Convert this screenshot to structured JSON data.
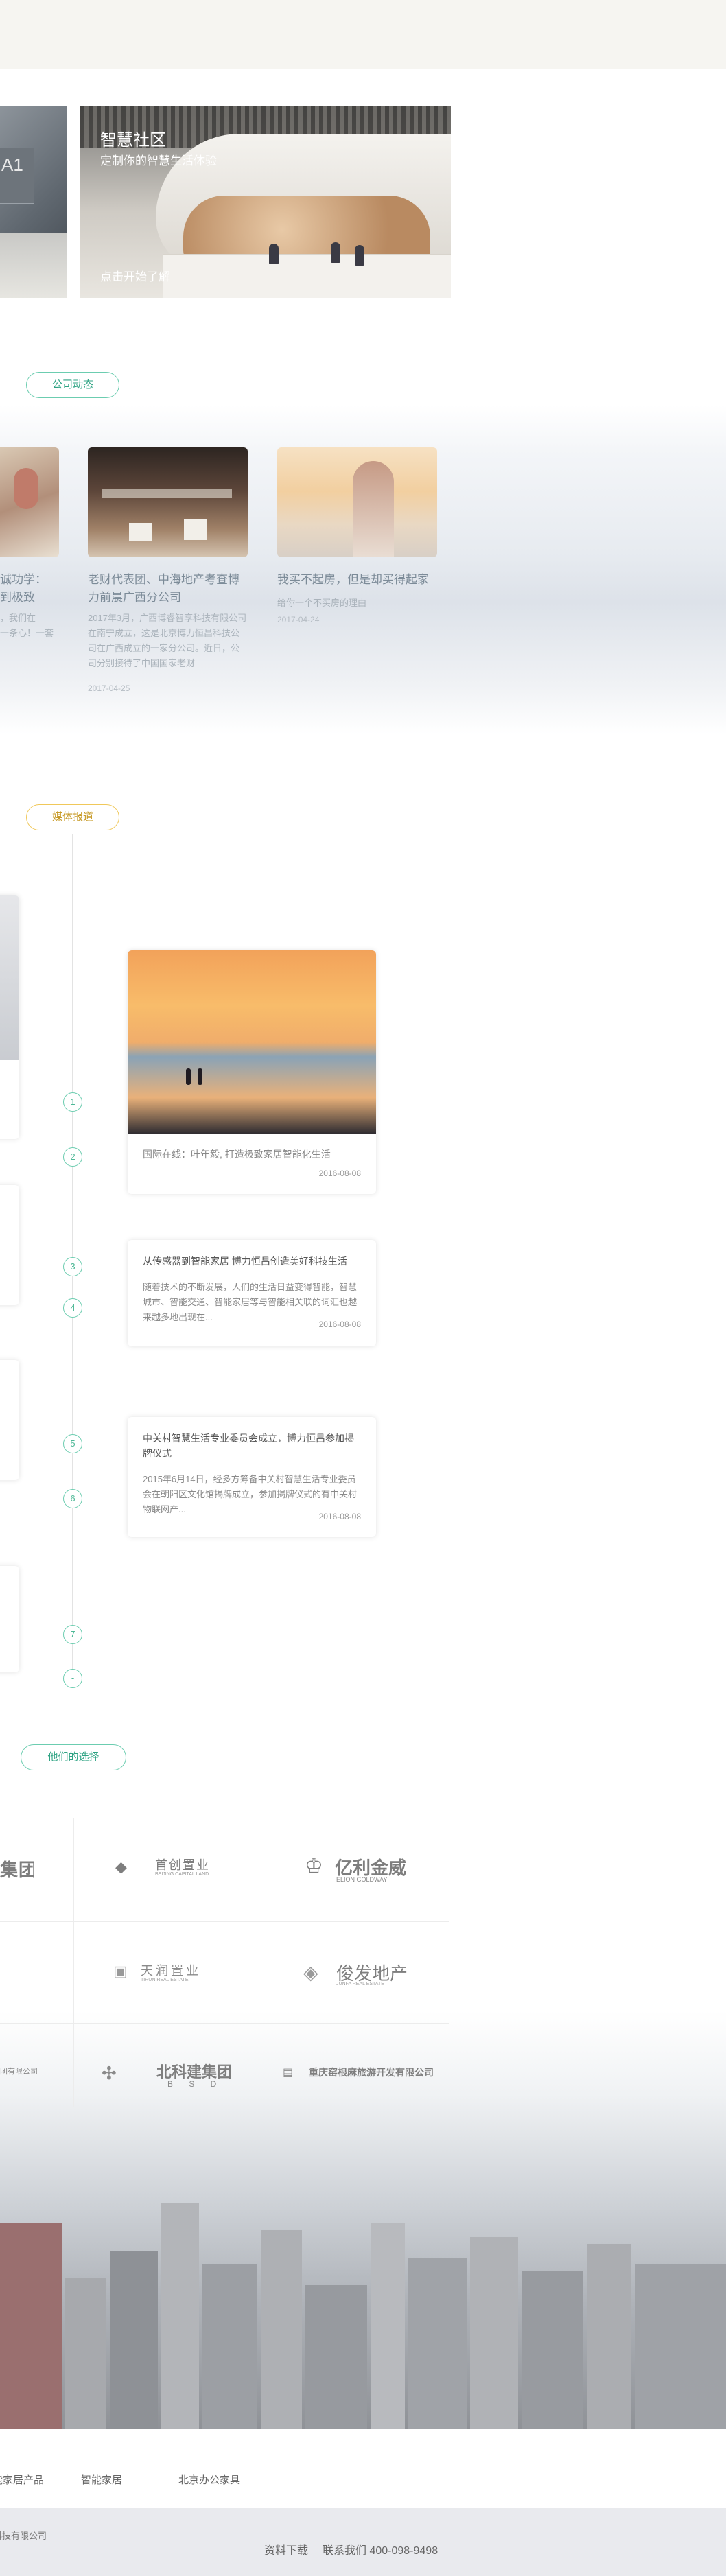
{
  "hero": {
    "plate_text": "A1",
    "title": "智慧社区",
    "subtitle": "定制你的智慧生活体验",
    "cta": "点击开始了解"
  },
  "news": {
    "section_label": "公司动态",
    "items": [
      {
        "title": "诚功学：",
        "title2": "到极致",
        "text": "，我们在",
        "text2": "一条心！一套"
      },
      {
        "title": "老财代表团、中海地产考查博力前晨广西分公司",
        "text": "2017年3月，广西博睿智享科技有限公司在南宁成立，这是北京博力恒昌科技公司在广西成立的一家分公司。近日，公司分别接待了中国国家老财",
        "date": "2017-04-25"
      },
      {
        "title": "我买不起房，但是却买得起家",
        "text": "给你一个不买房的理由",
        "date": "2017-04-24"
      }
    ]
  },
  "media": {
    "section_label": "媒体报道",
    "nodes": [
      "1",
      "2",
      "3",
      "4",
      "5",
      "6",
      "7",
      "-"
    ],
    "cards": [
      {
        "title": "国际在线：叶年毅, 打造极致家居智能化生活",
        "date": "2016-08-08"
      },
      {
        "title": "从传感器到智能家居 博力恒昌创造美好科技生活",
        "text": "随着技术的不断发展，人们的生活日益变得智能，智慧城市、智能交通、智能家居等与智能相关联的词汇也越来越多地出现在...",
        "date": "2016-08-08"
      },
      {
        "title": "中关村智慧生活专业委员会成立，博力恒昌参加揭牌仪式",
        "text": "2015年6月14日，经多方筹备中关村智慧生活专业委员会在朝阳区文化馆揭牌成立，参加揭牌仪式的有中关村物联网产...",
        "date": "2016-08-08"
      }
    ]
  },
  "clients": {
    "section_label": "他们的选择",
    "logos": [
      {
        "name": "集团",
        "sub": ""
      },
      {
        "name": "首创置业",
        "sub": "BEIJING CAPITAL LAND"
      },
      {
        "name": "亿利金威",
        "sub": "ELION GOLDWAY"
      },
      {
        "name": "天润置业",
        "sub": "TIRUN REAL ESTATE"
      },
      {
        "name": "俊发地产",
        "sub": "JUNFA REAL ESTATE"
      },
      {
        "name": "团有限公司",
        "sub": ""
      },
      {
        "name": "北科建集团",
        "sub": "B S D"
      },
      {
        "name": "重庆窑根麻旅游开发有限公司",
        "sub": ""
      }
    ]
  },
  "footer": {
    "links": [
      "智能家居产品",
      "智能家居",
      "北京办公家具"
    ],
    "copyright": "恒昌科技有限公司",
    "download": "资料下载",
    "contact": "联系我们 400-098-9498"
  },
  "colors": {
    "accent": "#2ea383",
    "accent_border": "#6ccdb0",
    "gold": "#c79a26"
  }
}
